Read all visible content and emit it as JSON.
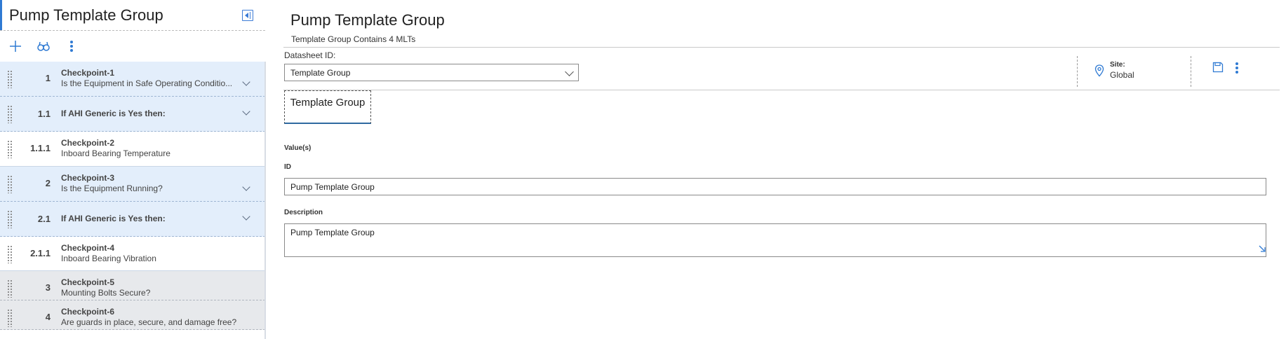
{
  "left_panel": {
    "title": "Pump Template Group",
    "toolbar": {
      "add_icon": "plus-icon",
      "search_icon": "binoculars-icon",
      "more_icon": "kebab-icon"
    },
    "items": [
      {
        "number": "1",
        "title": "Checkpoint-1",
        "description": "Is the Equipment in Safe Operating Conditio...",
        "expandable": true,
        "style": "blue"
      },
      {
        "number": "1.1",
        "title": "If AHI Generic is Yes then:",
        "description": "",
        "expandable": true,
        "style": "blue"
      },
      {
        "number": "1.1.1",
        "title": "Checkpoint-2",
        "description": "Inboard Bearing Temperature",
        "expandable": false,
        "style": "white"
      },
      {
        "number": "2",
        "title": "Checkpoint-3",
        "description": "Is the Equipment Running?",
        "expandable": true,
        "style": "blue"
      },
      {
        "number": "2.1",
        "title": "If AHI Generic is Yes then:",
        "description": "",
        "expandable": true,
        "style": "blue"
      },
      {
        "number": "2.1.1",
        "title": "Checkpoint-4",
        "description": "Inboard Bearing Vibration",
        "expandable": false,
        "style": "white"
      },
      {
        "number": "3",
        "title": "Checkpoint-5",
        "description": "Mounting Bolts Secure?",
        "expandable": false,
        "style": "gray"
      },
      {
        "number": "4",
        "title": "Checkpoint-6",
        "description": "Are guards in place, secure, and damage free?",
        "expandable": false,
        "style": "gray"
      }
    ]
  },
  "main": {
    "title": "Pump Template Group",
    "subtitle": "Template Group Contains 4 MLTs",
    "datasheet_label": "Datasheet ID:",
    "datasheet_value": "Template Group",
    "site_label": "Site:",
    "site_value": "Global",
    "tab_label": "Template Group",
    "values_label": "Value(s)",
    "id_label": "ID",
    "id_value": "Pump Template Group",
    "description_label": "Description",
    "description_value": "Pump Template Group"
  },
  "colors": {
    "accent": "#2f7ad3",
    "row_blue": "#e3eefb",
    "row_gray": "#e7e9ec"
  }
}
